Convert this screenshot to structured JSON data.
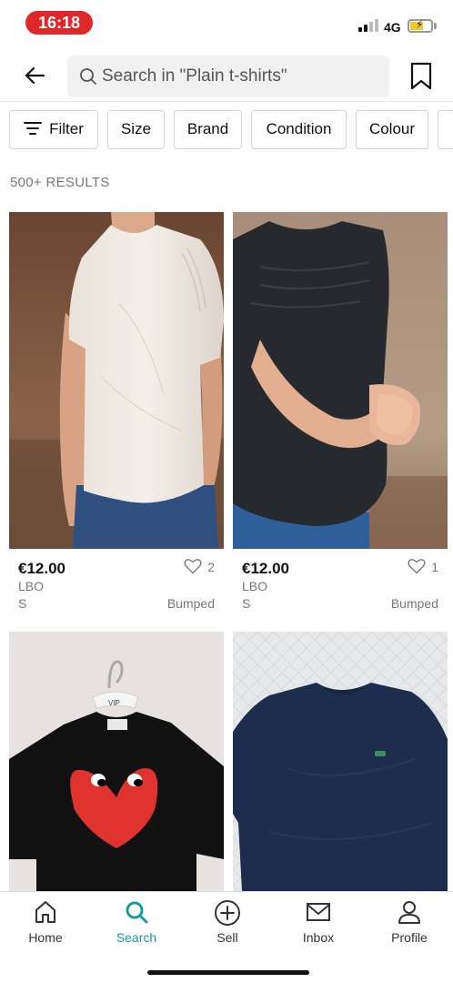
{
  "status_bar": {
    "time": "16:18",
    "network": "4G"
  },
  "header": {
    "search_placeholder": "Search in \"Plain t-shirts\""
  },
  "filters": [
    {
      "label": "Filter"
    },
    {
      "label": "Size"
    },
    {
      "label": "Brand"
    },
    {
      "label": "Condition"
    },
    {
      "label": "Colour"
    }
  ],
  "results": {
    "count_label": "500+ RESULTS"
  },
  "items": [
    {
      "price": "€12.00",
      "brand": "LBO",
      "size": "S",
      "favourites": "2",
      "status": "Bumped"
    },
    {
      "price": "€12.00",
      "brand": "LBO",
      "size": "S",
      "favourites": "1",
      "status": "Bumped"
    },
    {
      "price": "",
      "brand": "",
      "size": "",
      "favourites": "",
      "status": ""
    },
    {
      "price": "",
      "brand": "",
      "size": "",
      "favourites": "",
      "status": ""
    }
  ],
  "hanger_label": "VIP",
  "nav": {
    "home": "Home",
    "search": "Search",
    "sell": "Sell",
    "inbox": "Inbox",
    "profile": "Profile"
  },
  "colors": {
    "accent": "#1b9aa0",
    "time_pill": "#e0282a"
  }
}
